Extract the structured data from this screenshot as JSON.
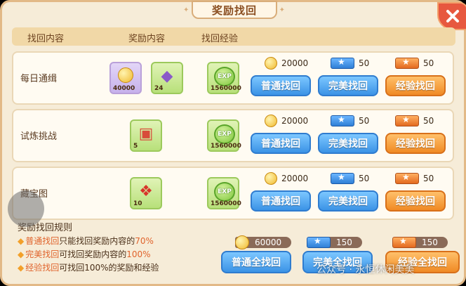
{
  "title": "奖励找回",
  "header": {
    "col1": "找回内容",
    "col2": "奖励内容",
    "col3": "找回经验"
  },
  "rows": [
    {
      "label": "每日通缉",
      "items": [
        {
          "qty": "40000",
          "icon": "coin-icon"
        },
        {
          "qty": "24",
          "icon": "crystal-icon"
        }
      ],
      "exp": "1560000",
      "costs": {
        "coin": "20000",
        "blue_ticket": "50",
        "orange_ticket": "50"
      }
    },
    {
      "label": "试炼挑战",
      "items": [
        {
          "qty": "5",
          "icon": "treasure-chest-icon"
        }
      ],
      "exp": "1560000",
      "costs": {
        "coin": "20000",
        "blue_ticket": "50",
        "orange_ticket": "50"
      }
    },
    {
      "label": "藏宝图",
      "items": [
        {
          "qty": "10",
          "icon": "gift-box-icon"
        }
      ],
      "exp": "1560000",
      "costs": {
        "coin": "20000",
        "blue_ticket": "50",
        "orange_ticket": "50"
      }
    }
  ],
  "exp_label": "EXP",
  "buttons": {
    "normal": "普通找回",
    "perfect": "完美找回",
    "exp": "经验找回"
  },
  "rules": {
    "title": "奖励找回规则",
    "r1_hl": "普通找回",
    "r1_a": "只能找回奖励内容的",
    "r1_pct": "70%",
    "r2_hl": "完美找回",
    "r2_a": "可找回奖励内容的",
    "r2_pct": "100%",
    "r3_hl": "经验找回",
    "r3_a": "可找回100%的奖励和经验"
  },
  "bottom": {
    "coin_total": "60000",
    "blue_total": "150",
    "orange_total": "150",
    "normal_all": "普通全找回",
    "perfect_all": "完美全找回",
    "exp_all": "经验全找回"
  },
  "watermark": "公众号 · 永恒休闲美美",
  "colors": {
    "blue_button": "#3b93e6",
    "orange_button": "#f08a24",
    "highlight": "#e0632c"
  }
}
